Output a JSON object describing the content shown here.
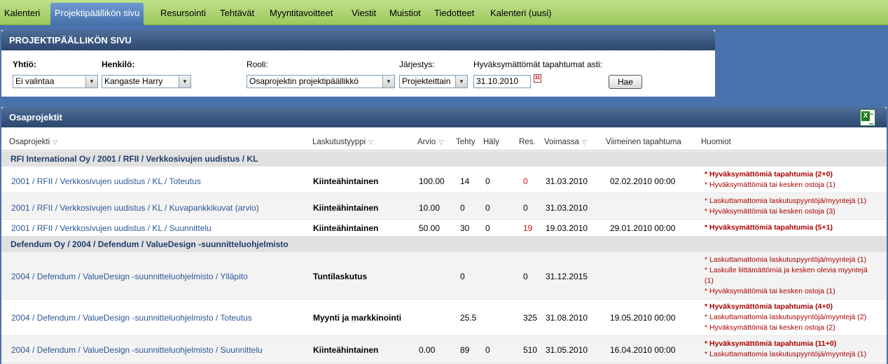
{
  "nav": {
    "tabs": [
      {
        "label": "Kalenteri",
        "active": false
      },
      {
        "label": "Projektipäällikön sivu",
        "active": true
      },
      {
        "label": "Resursointi",
        "active": false
      },
      {
        "label": "Tehtävät",
        "active": false
      },
      {
        "label": "Myyntitavoitteet",
        "active": false
      },
      {
        "label": "Viestit",
        "active": false
      },
      {
        "label": "Muistiot",
        "active": false
      },
      {
        "label": "Tiedotteet",
        "active": false
      },
      {
        "label": "Kalenteri (uusi)",
        "active": false
      }
    ]
  },
  "filter": {
    "title": "PROJEKTIPÄÄLLIKÖN SIVU",
    "company_label": "Yhtiö:",
    "company_value": "Ei valintaa",
    "person_label": "Henkilö:",
    "person_value": "Kangaste Harry",
    "role_label": "Rooli:",
    "role_value": "Osaprojektin projektipäällikkö",
    "order_label": "Järjestys:",
    "order_value": "Projekteittain",
    "unapproved_label": "Hyväksymättömät tapahtumat asti:",
    "unapproved_date": "31.10.2010",
    "search_button": "Hae"
  },
  "list": {
    "title": "Osaprojektit",
    "columns": {
      "subproject": "Osaprojekti",
      "billing_type": "Laskutustyyppi",
      "estimate": "Arvio",
      "done": "Tehty",
      "haly": "Häly",
      "res": "Res.",
      "valid": "Voimassa",
      "last_event": "Viimeinen tapahtuma",
      "notes": "Huomiot"
    },
    "groups": [
      {
        "title": "RFI International Oy / 2001 / RFII / Verkkosivujen uudistus / KL",
        "rows": [
          {
            "name": "2001 / RFII / Verkkosivujen uudistus / KL / Toteutus",
            "type": "Kiinteähintainen",
            "estimate": "100.00",
            "done": "14",
            "haly": "0",
            "res": "0",
            "res_red": true,
            "valid": "31.03.2010",
            "last": "02.02.2010 00:00",
            "notes": [
              {
                "text": "* Hyväksymättömiä tapahtumia (2+0)",
                "bold": true
              },
              {
                "text": "* Hyväksymättömiä tai kesken ostoja (1)",
                "bold": false
              }
            ]
          },
          {
            "name": "2001 / RFII / Verkkosivujen uudistus / KL / Kuvapankkikuvat (arvio)",
            "type": "Kiinteähintainen",
            "estimate": "10.00",
            "done": "0",
            "haly": "0",
            "res": "0",
            "res_red": false,
            "valid": "31.03.2010",
            "last": "",
            "notes": [
              {
                "text": "* Laskuttamattomia laskutuspyyntöjä/myyntejä (1)",
                "bold": false
              },
              {
                "text": "* Hyväksymättömiä tai kesken ostoja (3)",
                "bold": false
              }
            ]
          },
          {
            "name": "2001 / RFII / Verkkosivujen uudistus / KL / Suunnittelu",
            "type": "Kiinteähintainen",
            "estimate": "50.00",
            "done": "30",
            "haly": "0",
            "res": "19",
            "res_red": true,
            "valid": "19.03.2010",
            "last": "29.01.2010 00:00",
            "notes": [
              {
                "text": "* Hyväksymättömiä tapahtumia (5+1)",
                "bold": true
              }
            ]
          }
        ]
      },
      {
        "title": "Defendum Oy / 2004 / Defendum / ValueDesign -suunnitteluohjelmisto",
        "rows": [
          {
            "name": "2004 / Defendum / ValueDesign -suunnitteluohjelmisto / Ylläpito",
            "type": "Tuntilaskutus",
            "estimate": "",
            "done": "0",
            "haly": "",
            "res": "0",
            "res_red": false,
            "valid": "31.12.2015",
            "last": "",
            "notes": [
              {
                "text": "* Laskuttamattomia laskutuspyyntöjä/myyntejä (1)",
                "bold": false
              },
              {
                "text": "* Laskulle liittämättömiä ja kesken olevia myyntejä (1)",
                "bold": false
              },
              {
                "text": "* Hyväksymättömiä tai kesken ostoja (1)",
                "bold": false
              }
            ]
          },
          {
            "name": "2004 / Defendum / ValueDesign -suunnitteluohjelmisto / Toteutus",
            "type": "Myynti ja markkinointi",
            "estimate": "",
            "done": "25.5",
            "haly": "",
            "res": "325",
            "res_red": false,
            "valid": "31.08.2010",
            "last": "19.05.2010 00:00",
            "notes": [
              {
                "text": "* Hyväksymättömiä tapahtumia (4+0)",
                "bold": true
              },
              {
                "text": "* Laskuttamattomia laskutuspyyntöjä/myyntejä (2)",
                "bold": false
              },
              {
                "text": "* Hyväksymättömiä tai kesken ostoja (2)",
                "bold": false
              }
            ]
          },
          {
            "name": "2004 / Defendum / ValueDesign -suunnitteluohjelmisto / Suunnittelu",
            "type": "Kiinteähintainen",
            "estimate": "0.00",
            "done": "89",
            "haly": "0",
            "res": "510",
            "res_red": false,
            "valid": "31.05.2010",
            "last": "16.04.2010 00:00",
            "notes": [
              {
                "text": "* Hyväksymättömiä tapahtumia (11+0)",
                "bold": true
              },
              {
                "text": "* Laskuttamattomia laskutuspyyntöjä/myyntejä (1)",
                "bold": false
              }
            ]
          }
        ]
      }
    ]
  }
}
